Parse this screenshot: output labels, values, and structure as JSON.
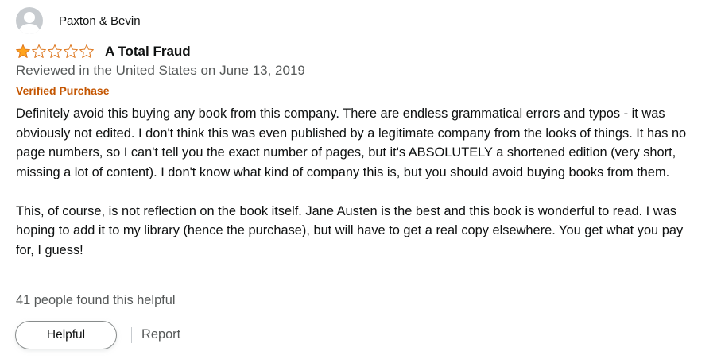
{
  "reviewer": {
    "name": "Paxton & Bevin",
    "avatar_icon": "user-silhouette-icon"
  },
  "rating": {
    "value": 1,
    "max": 5,
    "filled_color": "#ffa41c",
    "outline_color": "#de7921"
  },
  "review": {
    "title": "A Total Fraud",
    "date_line": "Reviewed in the United States on June 13, 2019",
    "verified_label": "Verified Purchase",
    "paragraphs": [
      "Definitely avoid this buying any book from this company. There are endless grammatical errors and typos - it was obviously not edited. I don't think this was even published by a legitimate company from the looks of things. It has no page numbers, so I can't tell you the exact number of pages, but it's ABSOLUTELY a shortened edition (very short, missing a lot of content). I don't know what kind of company this is, but you should avoid buying books from them.",
      "This, of course, is not reflection on the book itself. Jane Austen is the best and this book is wonderful to read. I was hoping to add it to my library (hence the purchase), but will have to get a real copy elsewhere. You get what you pay for, I guess!"
    ],
    "helpful_count_text": "41 people found this helpful"
  },
  "actions": {
    "helpful_label": "Helpful",
    "report_label": "Report"
  },
  "colors": {
    "text": "#0f1111",
    "secondary_text": "#565959",
    "verified": "#c45500",
    "avatar_bg": "#c7cbcf"
  }
}
